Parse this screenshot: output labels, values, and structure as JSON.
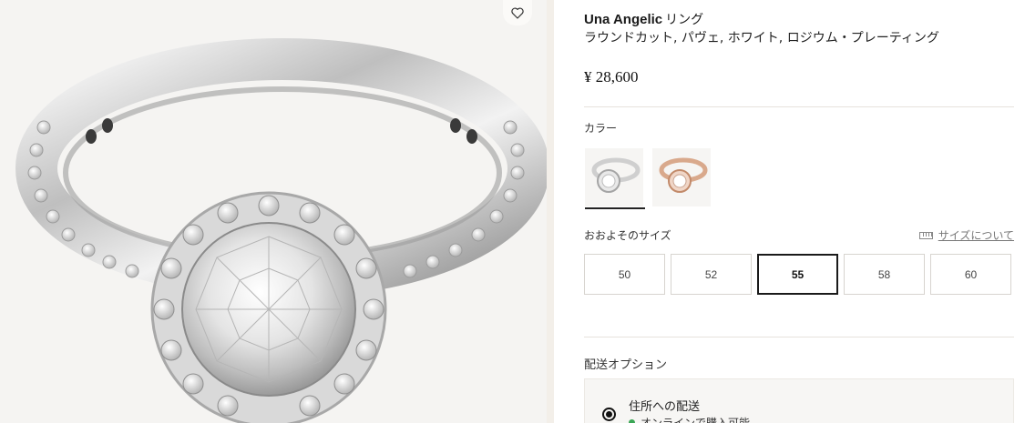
{
  "wishlist": {
    "icon": "heart-icon"
  },
  "product": {
    "brand": "Una Angelic",
    "kind": "リング",
    "subtitle": "ラウンドカット, パヴェ, ホワイト, ロジウム・プレーティング",
    "price": "¥ 28,600"
  },
  "color": {
    "label": "カラー",
    "swatches": [
      {
        "name": "silver",
        "accent": "#c9c9c9",
        "selected": true
      },
      {
        "name": "rose-gold",
        "accent": "#d6a88e",
        "selected": false
      }
    ]
  },
  "size": {
    "label": "おおよそのサイズ",
    "guide_link": "サイズについて",
    "guide_icon": "ruler-icon",
    "options": [
      "50",
      "52",
      "55",
      "58",
      "60"
    ],
    "selected": "55"
  },
  "delivery": {
    "label": "配送オプション",
    "option": "住所への配送",
    "status": "オンラインで購入可能",
    "status_color": "#3aa655"
  }
}
